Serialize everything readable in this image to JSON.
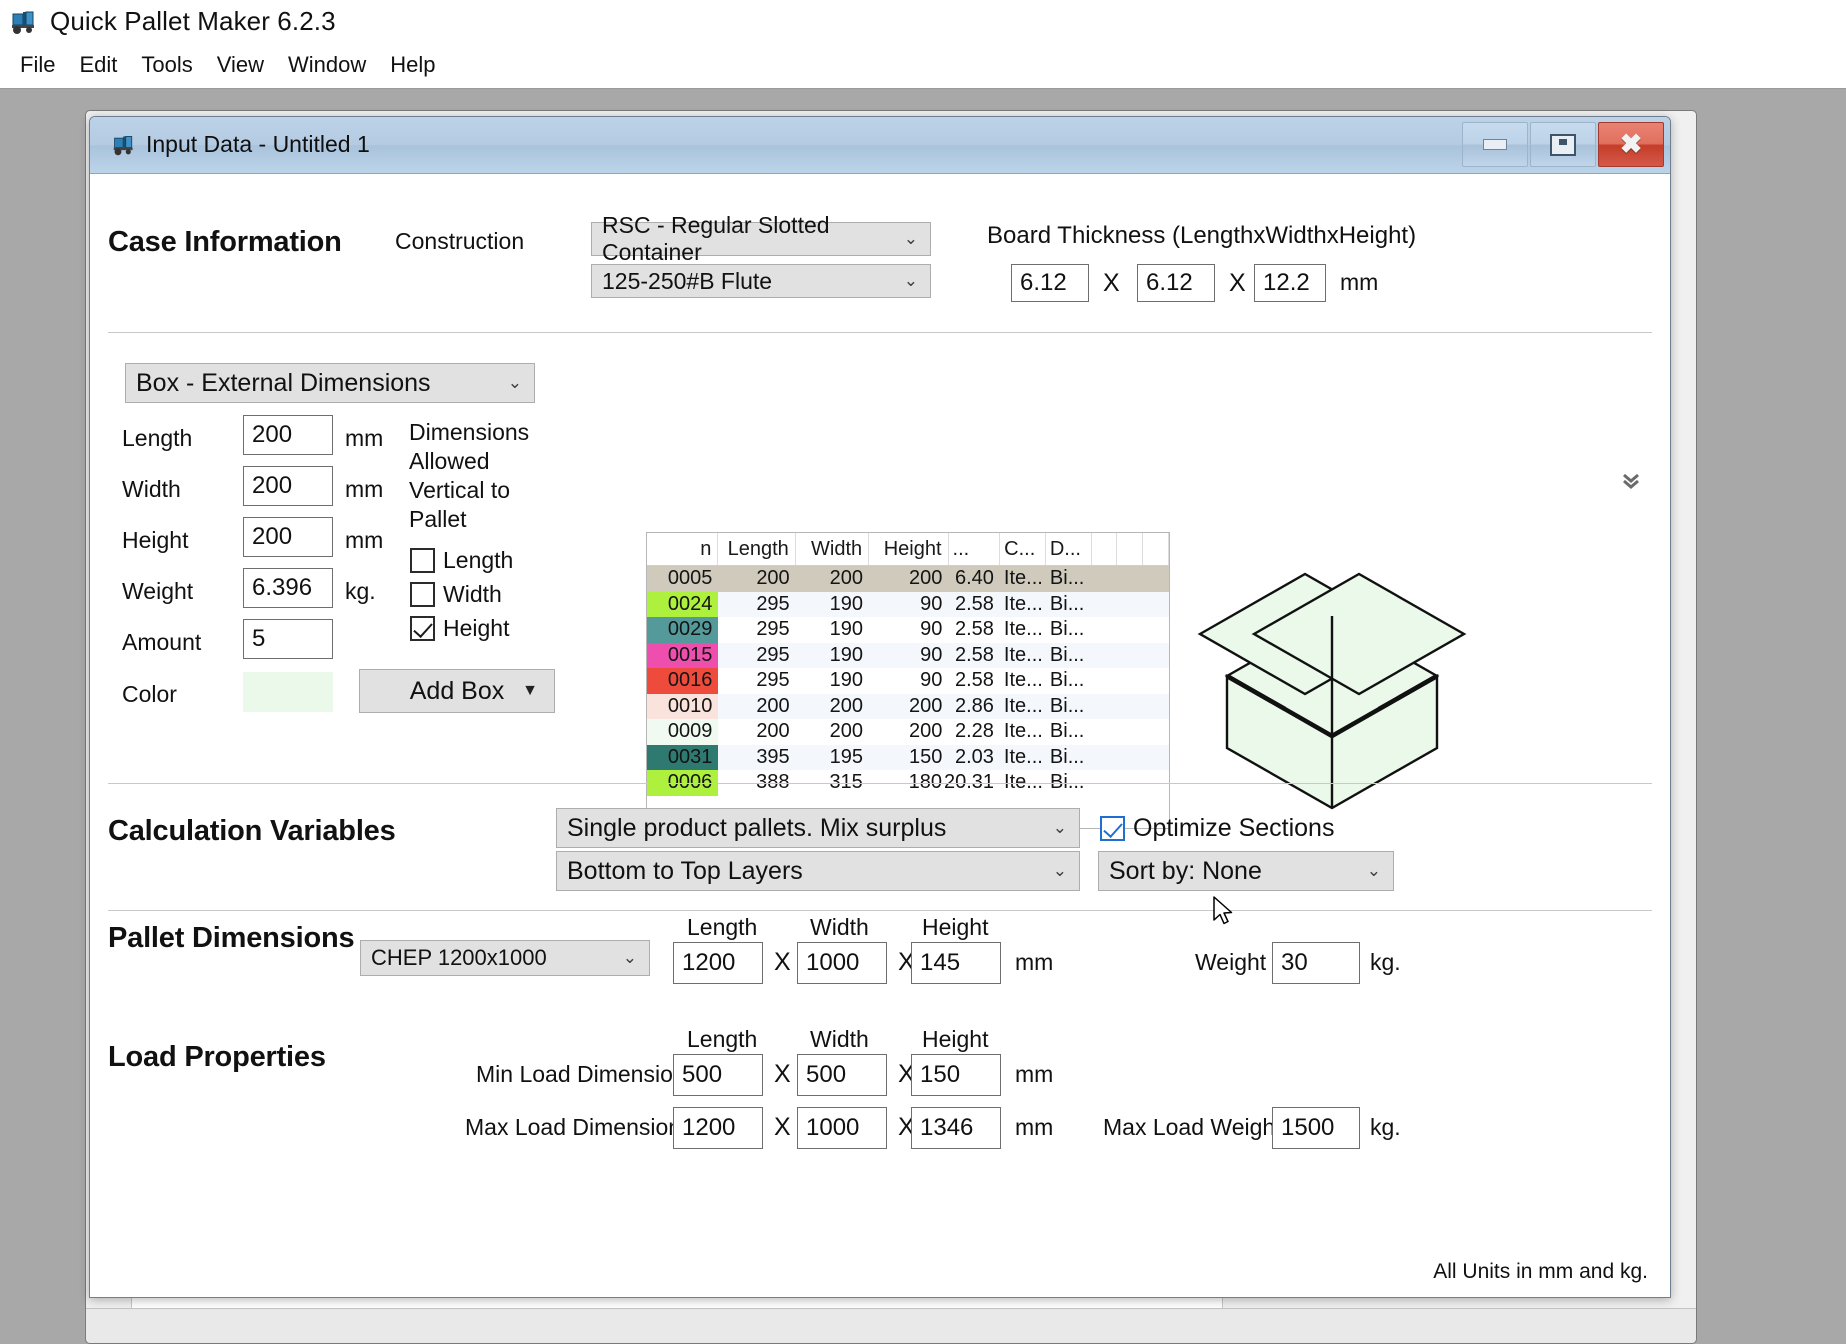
{
  "app": {
    "title": "Quick Pallet Maker 6.2.3",
    "icon": "forklift-icon",
    "menu": [
      "File",
      "Edit",
      "Tools",
      "View",
      "Window",
      "Help"
    ]
  },
  "dialog": {
    "title": "Input Data - Untitled 1",
    "icon": "forklift-icon",
    "window_buttons": {
      "minimize": "minimize-icon",
      "restore": "restore-icon",
      "close": "close-icon"
    },
    "footnote": "All Units in mm and kg."
  },
  "case_information": {
    "heading": "Case Information",
    "construction_label": "Construction",
    "construction_value": "RSC - Regular Slotted Container",
    "flute_value": "125-250#B Flute",
    "board_thickness_label": "Board Thickness (LengthxWidthxHeight)",
    "board_length": "6.12",
    "board_width": "6.12",
    "board_height": "12.2",
    "unit": "mm",
    "sep": "X"
  },
  "box_panel": {
    "mode_value": "Box - External Dimensions",
    "length_label": "Length",
    "length_value": "200",
    "width_label": "Width",
    "width_value": "200",
    "height_label": "Height",
    "height_value": "200",
    "weight_label": "Weight",
    "weight_value": "6.396",
    "amount_label": "Amount",
    "amount_value": "5",
    "color_label": "Color",
    "color_swatch": "#eaf9ea",
    "unit_mm": "mm",
    "unit_kg": "kg.",
    "allowed_title": "Dimensions Allowed Vertical to Pallet",
    "allowed": [
      {
        "label": "Length",
        "checked": false
      },
      {
        "label": "Width",
        "checked": false
      },
      {
        "label": "Height",
        "checked": true
      }
    ],
    "add_box_label": "Add Box",
    "expander_icon": "chevron-double-down-icon"
  },
  "box_table": {
    "columns": [
      "n",
      "Length",
      "Width",
      "Height",
      "...",
      "C...",
      "D...",
      "",
      "",
      ""
    ],
    "rows": [
      {
        "n": "0005",
        "length": "200",
        "width": "200",
        "height": "200",
        "dots": "6.40",
        "c": "Ite...",
        "d": "Bi...",
        "color": "#cfcabc",
        "selected": true
      },
      {
        "n": "0024",
        "length": "295",
        "width": "190",
        "height": "90",
        "dots": "2.58",
        "c": "Ite...",
        "d": "Bi...",
        "color": "#aef03e",
        "selected": false
      },
      {
        "n": "0029",
        "length": "295",
        "width": "190",
        "height": "90",
        "dots": "2.58",
        "c": "Ite...",
        "d": "Bi...",
        "color": "#549a9a",
        "selected": false
      },
      {
        "n": "0015",
        "length": "295",
        "width": "190",
        "height": "90",
        "dots": "2.58",
        "c": "Ite...",
        "d": "Bi...",
        "color": "#ee4fae",
        "selected": false
      },
      {
        "n": "0016",
        "length": "295",
        "width": "190",
        "height": "90",
        "dots": "2.58",
        "c": "Ite...",
        "d": "Bi...",
        "color": "#ef4b3c",
        "selected": false
      },
      {
        "n": "0010",
        "length": "200",
        "width": "200",
        "height": "200",
        "dots": "2.86",
        "c": "Ite...",
        "d": "Bi...",
        "color": "#fbe3dd",
        "selected": false
      },
      {
        "n": "0009",
        "length": "200",
        "width": "200",
        "height": "200",
        "dots": "2.28",
        "c": "Ite...",
        "d": "Bi...",
        "color": "#f0faf0",
        "selected": false
      },
      {
        "n": "0031",
        "length": "395",
        "width": "195",
        "height": "150",
        "dots": "2.03",
        "c": "Ite...",
        "d": "Bi...",
        "color": "#2f7a70",
        "selected": false
      },
      {
        "n": "0006",
        "length": "388",
        "width": "315",
        "height": "180",
        "dots": "20.31",
        "c": "Ite...",
        "d": "Bi...",
        "color": "#aef03e",
        "selected": false
      }
    ]
  },
  "calculation_variables": {
    "heading": "Calculation Variables",
    "mode_value": "Single product pallets. Mix surplus",
    "order_value": "Bottom to Top Layers",
    "optimize_label": "Optimize Sections",
    "optimize_checked": true,
    "sort_value": "Sort by: None"
  },
  "pallet_dimensions": {
    "heading": "Pallet Dimensions",
    "preset_value": "CHEP 1200x1000",
    "length_label": "Length",
    "width_label": "Width",
    "height_label": "Height",
    "length_value": "1200",
    "width_value": "1000",
    "height_value": "145",
    "unit": "mm",
    "weight_label": "Weight",
    "weight_value": "30",
    "weight_unit": "kg.",
    "sep": "X"
  },
  "load_properties": {
    "heading": "Load Properties",
    "length_label": "Length",
    "width_label": "Width",
    "height_label": "Height",
    "min_label": "Min Load Dimensions",
    "min_length": "500",
    "min_width": "500",
    "min_height": "150",
    "max_label": "Max Load Dimensions",
    "max_length": "1200",
    "max_width": "1000",
    "max_height": "1346",
    "unit": "mm",
    "max_weight_label": "Max Load Weight",
    "max_weight_value": "1500",
    "weight_unit": "kg.",
    "sep": "X"
  }
}
